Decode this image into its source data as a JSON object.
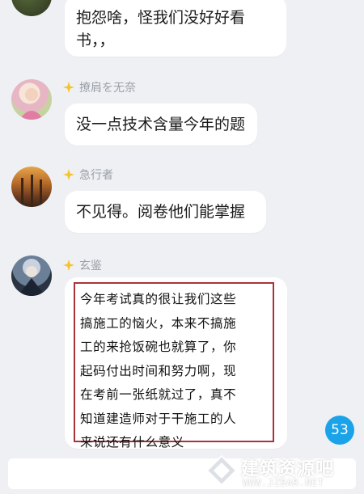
{
  "messages": [
    {
      "name": "",
      "lines": [
        "抱怨啥，怪我们没好好看",
        "书，，"
      ]
    },
    {
      "name": "撩肩を无奈",
      "lines": [
        "没一点技术含量今年的题"
      ]
    },
    {
      "name": "急行者",
      "lines": [
        "不见得。阅卷他们能掌握"
      ]
    },
    {
      "name": "玄鉴",
      "lines": []
    }
  ],
  "highlighted_post": {
    "lines": [
      "今年考试真的很让我们这些",
      "搞施工的恼火，本来不搞施",
      "工的来抢饭碗也就算了，你",
      "起码付出时间和努力啊，现",
      "在考前一张纸就过了，真不",
      "知道建造师对于干施工的人",
      "来说还有什么意义"
    ]
  },
  "unread_badge": "53",
  "watermark": {
    "text": "建筑资源吧",
    "url": "WWW.JZBAR.NET"
  },
  "colors": {
    "accent_red": "#a8343a",
    "badge_blue": "#1aa3e8",
    "star": "#f3c431",
    "bg": "#eef0f4"
  },
  "icons": [
    "star-icon",
    "avatar"
  ]
}
